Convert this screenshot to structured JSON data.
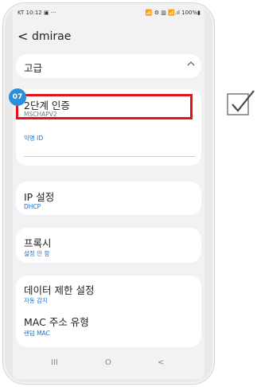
{
  "status_bar": {
    "time": "KT 10:12 ▣ ···",
    "right": "📶 ⚙ ▥ 📶.ıl 100%▮"
  },
  "header": {
    "back_glyph": "<",
    "title": "dmirae"
  },
  "advanced": {
    "label": "고급",
    "chevron_icon": "chevron-up-icon"
  },
  "badge": "07",
  "auth": {
    "label": "2단계 인증",
    "value": "MSCHAPV2"
  },
  "anonymous_id": {
    "label": "익명 ID",
    "value": ""
  },
  "ip": {
    "label": "IP 설정",
    "value": "DHCP"
  },
  "proxy": {
    "label": "프록시",
    "value": "설정 안 함"
  },
  "metered": {
    "label": "데이터 제한 설정",
    "value": "자동 감지"
  },
  "mac": {
    "label": "MAC 주소 유형",
    "value": "랜덤 MAC"
  },
  "nav": {
    "recents": "III",
    "home": "O",
    "back": "<"
  },
  "colors": {
    "highlight": "#e0141d",
    "badge": "#2c8fd8",
    "accent": "#1a73d9"
  },
  "check_icon": "checkmark-box-icon"
}
